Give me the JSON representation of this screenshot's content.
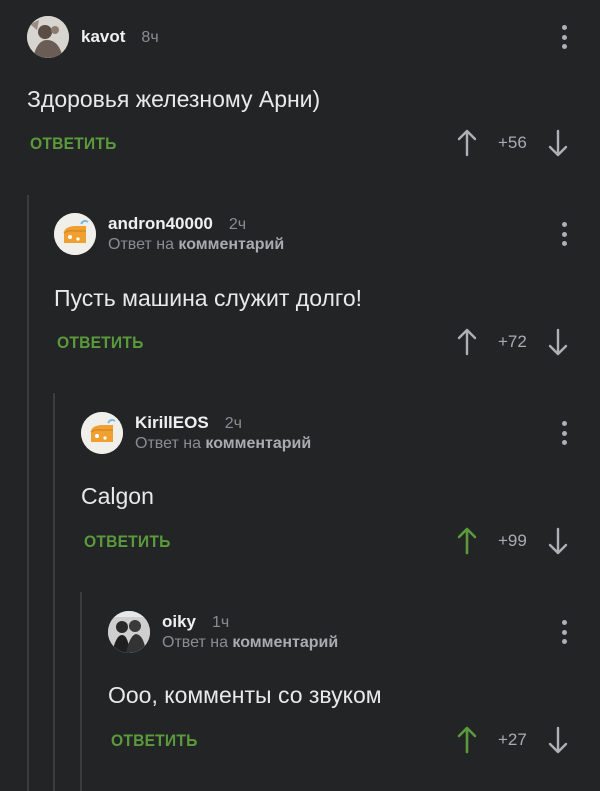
{
  "comments": [
    {
      "username": "kavot",
      "time": "8ч",
      "reply_prefix": "",
      "reply_target": "",
      "text": "Здоровья железному Арни)",
      "reply_label": "ОТВЕТИТЬ",
      "score": "+56",
      "upvoted": false
    },
    {
      "username": "andron40000",
      "time": "2ч",
      "reply_prefix": "Ответ на",
      "reply_target": "комментарий",
      "text": "Пусть машина служит долго!",
      "reply_label": "ОТВЕТИТЬ",
      "score": "+72",
      "upvoted": false
    },
    {
      "username": "KirillEOS",
      "time": "2ч",
      "reply_prefix": "Ответ на",
      "reply_target": "комментарий",
      "text": "Calgon",
      "reply_label": "ОТВЕТИТЬ",
      "score": "+99",
      "upvoted": true
    },
    {
      "username": "oiky",
      "time": "1ч",
      "reply_prefix": "Ответ на",
      "reply_target": "комментарий",
      "text": "Ооо, комменты со звуком",
      "reply_label": "ОТВЕТИТЬ",
      "score": "+27",
      "upvoted": true
    }
  ],
  "colors": {
    "background": "#232425",
    "accent_green": "#5b9a3c",
    "upvote_active": "#5b9a3c",
    "icon_gray": "#aeb1b4"
  },
  "icons": [
    "menu-dots-icon",
    "arrow-up-icon",
    "arrow-down-icon"
  ]
}
